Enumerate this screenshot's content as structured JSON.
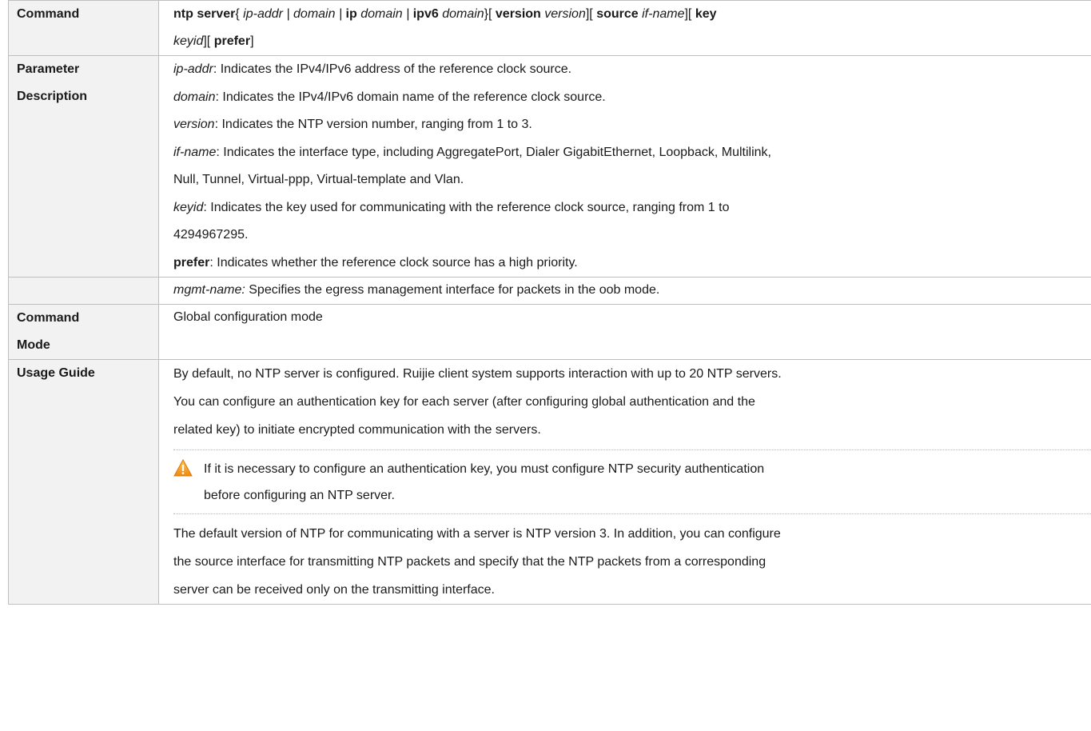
{
  "labels": {
    "command": "Command",
    "param_1": "Parameter",
    "param_2": "Description",
    "mode_1": "Command",
    "mode_2": "Mode",
    "usage": "Usage Guide"
  },
  "syntax": {
    "s1": "ntp server",
    "s2": "{ ",
    "s3": "ip-addr | domain | ",
    "s4": "ip",
    "s5": " domain | ",
    "s6": "ipv6",
    "s7": " domain",
    "s8": "}[ ",
    "s9": "version",
    "s10": " version",
    "s11": "][ ",
    "s12": "source",
    "s13": " if-name",
    "s14": "][ ",
    "s15": "key",
    "s16": "keyid",
    "s17": "][ ",
    "s18": "prefer",
    "s19": "]"
  },
  "params": {
    "ip_term": "ip-addr",
    "ip_desc": ": Indicates the IPv4/IPv6 address of the reference clock source.",
    "domain_term": "domain",
    "domain_desc": ": Indicates the IPv4/IPv6 domain name of the reference clock source.",
    "version_term": "version",
    "version_desc": ": Indicates the NTP version number, ranging from 1 to 3.",
    "ifname_term": "if-name",
    "ifname_desc1": ": Indicates the interface type, including AggregatePort, Dialer GigabitEthernet, Loopback, Multilink,",
    "ifname_desc2": "Null, Tunnel, Virtual-ppp, Virtual-template and Vlan.",
    "keyid_term": "keyid",
    "keyid_desc1": ": Indicates the key used for communicating with the reference clock source, ranging from 1 to",
    "keyid_desc2": "4294967295.",
    "prefer_term": "prefer",
    "prefer_desc": ": Indicates whether the reference clock source has a high priority.",
    "mgmt_term": "mgmt-name:",
    "mgmt_desc": " Specifies the egress management interface for packets in the oob mode."
  },
  "mode": {
    "value": "Global configuration mode"
  },
  "usage": {
    "p1_l1": "By default, no NTP server is configured. Ruijie client system supports interaction with up to 20 NTP servers.",
    "p1_l2": "You can configure an authentication key for each server (after configuring global authentication and the",
    "p1_l3": "related key) to initiate encrypted communication with the servers.",
    "warn_l1": "If it is necessary to configure an authentication key, you must configure NTP security authentication",
    "warn_l2": "before configuring an NTP server.",
    "p2_l1": "The default version of NTP for communicating with a server is NTP version 3. In addition, you can configure",
    "p2_l2": "the source interface for transmitting NTP packets and specify that the NTP packets from a corresponding",
    "p2_l3": "server can be received only on the transmitting interface."
  },
  "colors": {
    "label_bg": "#f2f2f2",
    "border": "#bfbfbf",
    "warning_icon": "#f5a623"
  },
  "icons": {
    "warning": "warning-triangle-icon"
  }
}
